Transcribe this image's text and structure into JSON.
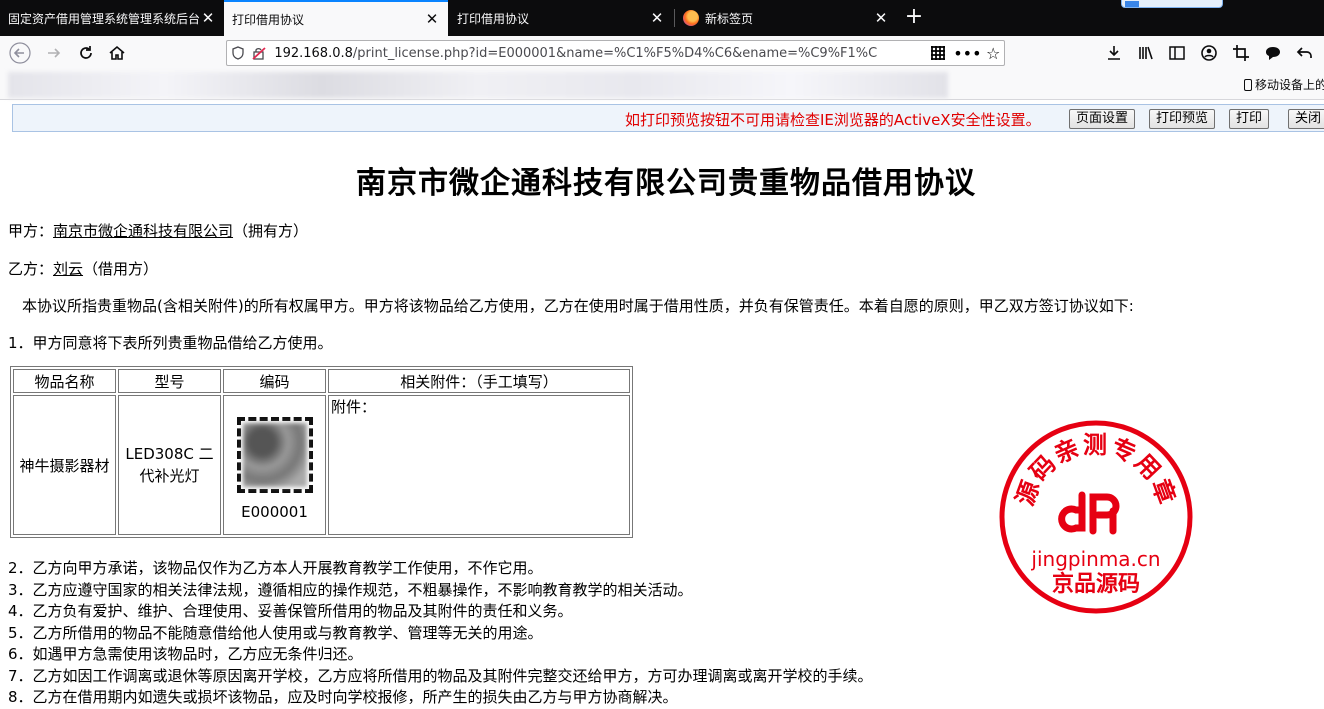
{
  "browser": {
    "tabs": [
      {
        "label": "固定资产借用管理系统管理系统后台"
      },
      {
        "label": "打印借用协议"
      },
      {
        "label": "打印借用协议"
      },
      {
        "label": "新标签页"
      }
    ],
    "url_host": "192.168.0.8",
    "url_path": "/print_license.php?id=E000001&name=%C1%F5%D4%C6&ename=%C9%F1%C",
    "mobile_bookmarks": "移动设备上的"
  },
  "print_bar": {
    "notice": "如打印预览按钮不可用请检查IE浏览器的ActiveX安全性设置。",
    "buttons": [
      "页面设置",
      "打印预览",
      "打印",
      "关闭"
    ]
  },
  "document": {
    "title": "南京市微企通科技有限公司贵重物品借用协议",
    "party_a_label": "甲方：",
    "party_a_name": "南京市微企通科技有限公司",
    "party_a_role": "（拥有方）",
    "party_b_label": "乙方：",
    "party_b_name": "刘云",
    "party_b_role": "（借用方）",
    "intro": "本协议所指贵重物品(含相关附件)的所有权属甲方。甲方将该物品给乙方使用，乙方在使用时属于借用性质，并负有保管责任。本着自愿的原则，甲乙双方签订协议如下:",
    "clause_1": "1．甲方同意将下表所列贵重物品借给乙方使用。",
    "table": {
      "headers": [
        "物品名称",
        "型号",
        "编码",
        "相关附件：（手工填写）"
      ],
      "row": {
        "name": "神牛摄影器材",
        "model": "LED308C 二代补光灯",
        "code": "E000001",
        "attachments": "附件："
      }
    },
    "clauses": [
      "2．乙方向甲方承诺，该物品仅作为乙方本人开展教育教学工作使用，不作它用。",
      "3．乙方应遵守国家的相关法律法规，遵循相应的操作规范，不粗暴操作，不影响教育教学的相关活动。",
      "4．乙方负有爱护、维护、合理使用、妥善保管所借用的物品及其附件的责任和义务。",
      "5．乙方所借用的物品不能随意借给他人使用或与教育教学、管理等无关的用途。",
      "6．如遇甲方急需使用该物品时，乙方应无条件归还。",
      "7．乙方如因工作调离或退休等原因离开学校，乙方应将所借用的物品及其附件完整交还给甲方，方可办理调离或离开学校的手续。",
      "8．乙方在借用期内如遗失或损坏该物品，应及时向学校报修，所产生的损失由乙方与甲方协商解决。"
    ]
  },
  "seal": {
    "arc_text": "源码亲测专用章",
    "site": "jingpinma.cn",
    "name": "京品源码",
    "color": "#e60012"
  },
  "colors": {
    "tab_strip": "#0c0c0d",
    "active_tab_accent": "#0a84ff",
    "notice_red": "#e00000"
  }
}
